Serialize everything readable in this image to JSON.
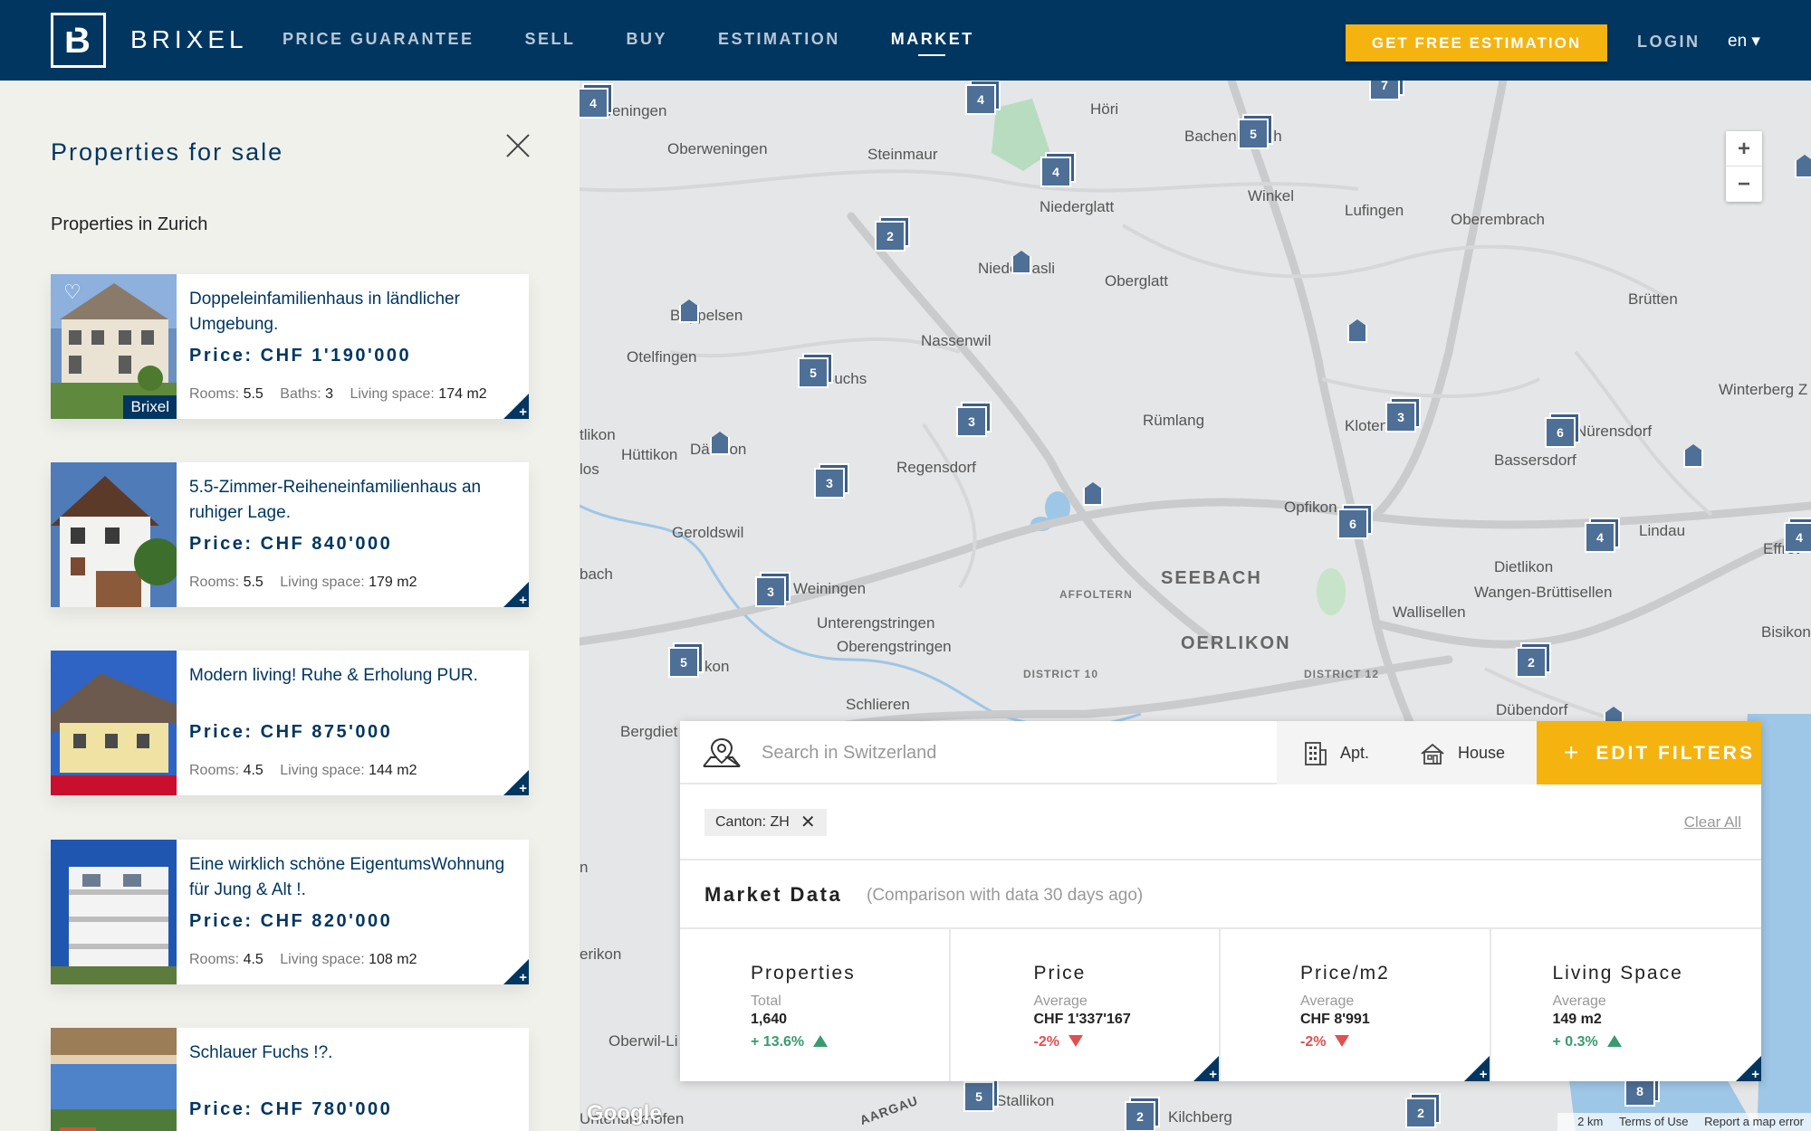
{
  "header": {
    "brand": "BRIXEL",
    "logo_letter": "B",
    "nav": [
      "PRICE GUARANTEE",
      "SELL",
      "BUY",
      "ESTIMATION",
      "MARKET"
    ],
    "active_nav": "MARKET",
    "cta": "GET FREE ESTIMATION",
    "login": "LOGIN",
    "lang": "en ▾",
    "bg_color": "#003660",
    "accent_color": "#f4b30f"
  },
  "sidebar": {
    "title": "Properties for sale",
    "subtitle": "Properties in Zurich",
    "listings": [
      {
        "title": "Doppeleinfamilienhaus in ländlicher Umgebung.",
        "price": "Price: CHF 1'190'000",
        "rooms_label": "Rooms:",
        "rooms": "5.5",
        "baths_label": "Baths:",
        "baths": "3",
        "space_label": "Living space:",
        "space": "174 m2",
        "tag": "Brixel"
      },
      {
        "title": "5.5-Zimmer-Reiheneinfamilienhaus an ruhiger Lage.",
        "price": "Price: CHF 840'000",
        "rooms_label": "Rooms:",
        "rooms": "5.5",
        "space_label": "Living space:",
        "space": "179 m2"
      },
      {
        "title": "Modern living! Ruhe & Erholung PUR.",
        "price": "Price: CHF 875'000",
        "rooms_label": "Rooms:",
        "rooms": "4.5",
        "space_label": "Living space:",
        "space": "144 m2"
      },
      {
        "title": "Eine wirklich schöne EigentumsWohnung für Jung & Alt !.",
        "price": "Price: CHF 820'000",
        "rooms_label": "Rooms:",
        "rooms": "4.5",
        "space_label": "Living space:",
        "space": "108 m2"
      },
      {
        "title": "Schlauer Fuchs !?.",
        "price": "Price: CHF 780'000"
      }
    ]
  },
  "map": {
    "places": [
      "rweningen",
      "Oberweningen",
      "Steinmaur",
      "Höri",
      "Bachenbülach",
      "Winkel",
      "Niederglatt",
      "Lufingen",
      "Oberembrach",
      "Niederhasli",
      "Oberglatt",
      "Brütten",
      "Boppelsen",
      "Nassenwil",
      "Otelfingen",
      "Buchs",
      "Winterberg Z",
      "Rümlang",
      "Kloten",
      "Bassersdorf",
      "Nürensdorf",
      "tlikon",
      "Hüttikon",
      "Dänikon",
      "Regensdorf",
      "los",
      "Opfikon",
      "Lindau",
      "Effret",
      "Dietlikon",
      "bach",
      "Geroldswil",
      "Weiningen",
      "SEEBACH",
      "AFFOLTERN",
      "Wallisellen",
      "Wangen-Brüttisellen",
      "Bisikon",
      "Unterengstringen",
      "Oberengstringen",
      "OERLIKON",
      "DISTRICT 10",
      "DISTRICT 12",
      "kon",
      "Schlieren",
      "Dübendorf",
      "Bergdiet",
      "erikon",
      "n",
      "Oberwil-Li",
      "Stallikon",
      "AARGAU",
      "Kilchberg",
      "Unterlunkhofen"
    ],
    "clusters": [
      "4",
      "4",
      "7",
      "5",
      "4",
      "2",
      "5",
      "3",
      "3",
      "3",
      "6",
      "6",
      "4",
      "4",
      "3",
      "5",
      "2",
      "5",
      "2",
      "2",
      "8"
    ],
    "zoom_in": "+",
    "zoom_out": "−",
    "google": "Google",
    "scale": "2 km",
    "terms": "Terms of Use",
    "report": "Report a map error"
  },
  "search": {
    "placeholder": "Search in Switzerland",
    "apt": "Apt.",
    "house": "House",
    "edit_plus": "+",
    "edit_filters": "EDIT FILTERS",
    "chip": "Canton: ZH",
    "chip_x": "✕",
    "clear_all": "Clear All",
    "market_title": "Market Data",
    "market_sub": "(Comparison with data 30 days ago)"
  },
  "stats": [
    {
      "label": "Properties",
      "sub": "Total",
      "value": "1,640",
      "change": "+ 13.6%",
      "direction": "up"
    },
    {
      "label": "Price",
      "sub": "Average",
      "value": "CHF 1'337'167",
      "change": "-2%",
      "direction": "down"
    },
    {
      "label": "Price/m2",
      "sub": "Average",
      "value": "CHF 8'991",
      "change": "-2%",
      "direction": "down"
    },
    {
      "label": "Living Space",
      "sub": "Average",
      "value": "149 m2",
      "change": "+ 0.3%",
      "direction": "up"
    }
  ]
}
